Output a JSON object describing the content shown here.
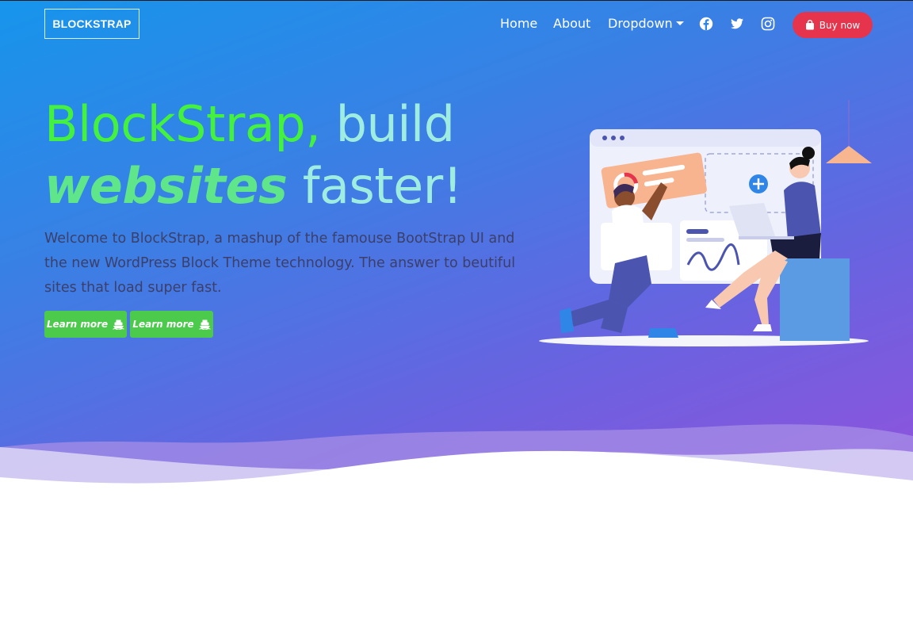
{
  "nav": {
    "logo_text": "BLOCKSTRAP",
    "links": [
      "Home",
      "About",
      "Dropdown"
    ],
    "social_icons": [
      "facebook-icon",
      "twitter-icon",
      "instagram-icon"
    ],
    "buy_label": "Buy now"
  },
  "hero": {
    "title_part1": "BlockStrap,",
    "title_part2": "build",
    "title_italic": "websites",
    "title_part3": "faster!",
    "description": "Welcome to BlockStrap, a mashup of the famouse BootStrap UI and the new WordPress Block Theme technology. The answer to beutiful sites that load super fast.",
    "buttons": [
      {
        "label": "Learn more",
        "icon": "ship-icon"
      },
      {
        "label": "Learn more",
        "icon": "ship-icon"
      }
    ]
  },
  "colors": {
    "gradient_start": "#1695ec",
    "gradient_end": "#9153dc",
    "buy_button": "#e5344b",
    "learn_button": "#4cca4c",
    "title_green": "#43f13e",
    "title_mint": "#9fece0"
  }
}
